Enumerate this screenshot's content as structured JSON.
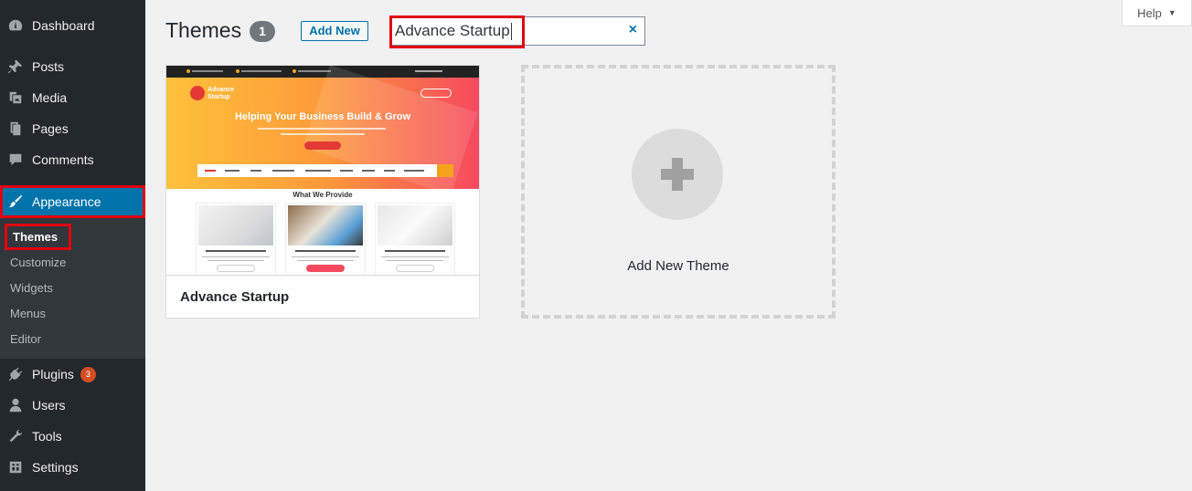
{
  "sidebar": {
    "items": [
      {
        "label": "Dashboard",
        "icon": "dashboard-icon"
      },
      {
        "label": "Posts",
        "icon": "pushpin-icon"
      },
      {
        "label": "Media",
        "icon": "media-icon"
      },
      {
        "label": "Pages",
        "icon": "pages-icon"
      },
      {
        "label": "Comments",
        "icon": "comment-icon"
      },
      {
        "label": "Appearance",
        "icon": "paintbrush-icon"
      },
      {
        "label": "Plugins",
        "icon": "plugin-icon",
        "badge": "3"
      },
      {
        "label": "Users",
        "icon": "user-icon"
      },
      {
        "label": "Tools",
        "icon": "wrench-icon"
      },
      {
        "label": "Settings",
        "icon": "settings-icon"
      }
    ],
    "submenu": [
      "Themes",
      "Customize",
      "Widgets",
      "Menus",
      "Editor"
    ]
  },
  "header": {
    "title": "Themes",
    "count": "1",
    "add_new_label": "Add New",
    "search_value": "Advance Startup",
    "clear_icon": "×",
    "help_label": "Help",
    "help_arrow": "▼"
  },
  "themes": [
    {
      "name": "Advance Startup",
      "screenshot": {
        "logo_line1": "Advance",
        "logo_line2": "Startup",
        "hero_title": "Helping Your Business Build & Grow",
        "section_title": "What We Provide"
      }
    }
  ],
  "add_new_theme_label": "Add New Theme",
  "colors": {
    "sidebar_bg": "#23282d",
    "active_menu": "#0073aa",
    "highlight": "#e3000f",
    "badge": "#d54e21",
    "hero_gradient": [
      "#fec13a",
      "#f6495e"
    ]
  }
}
